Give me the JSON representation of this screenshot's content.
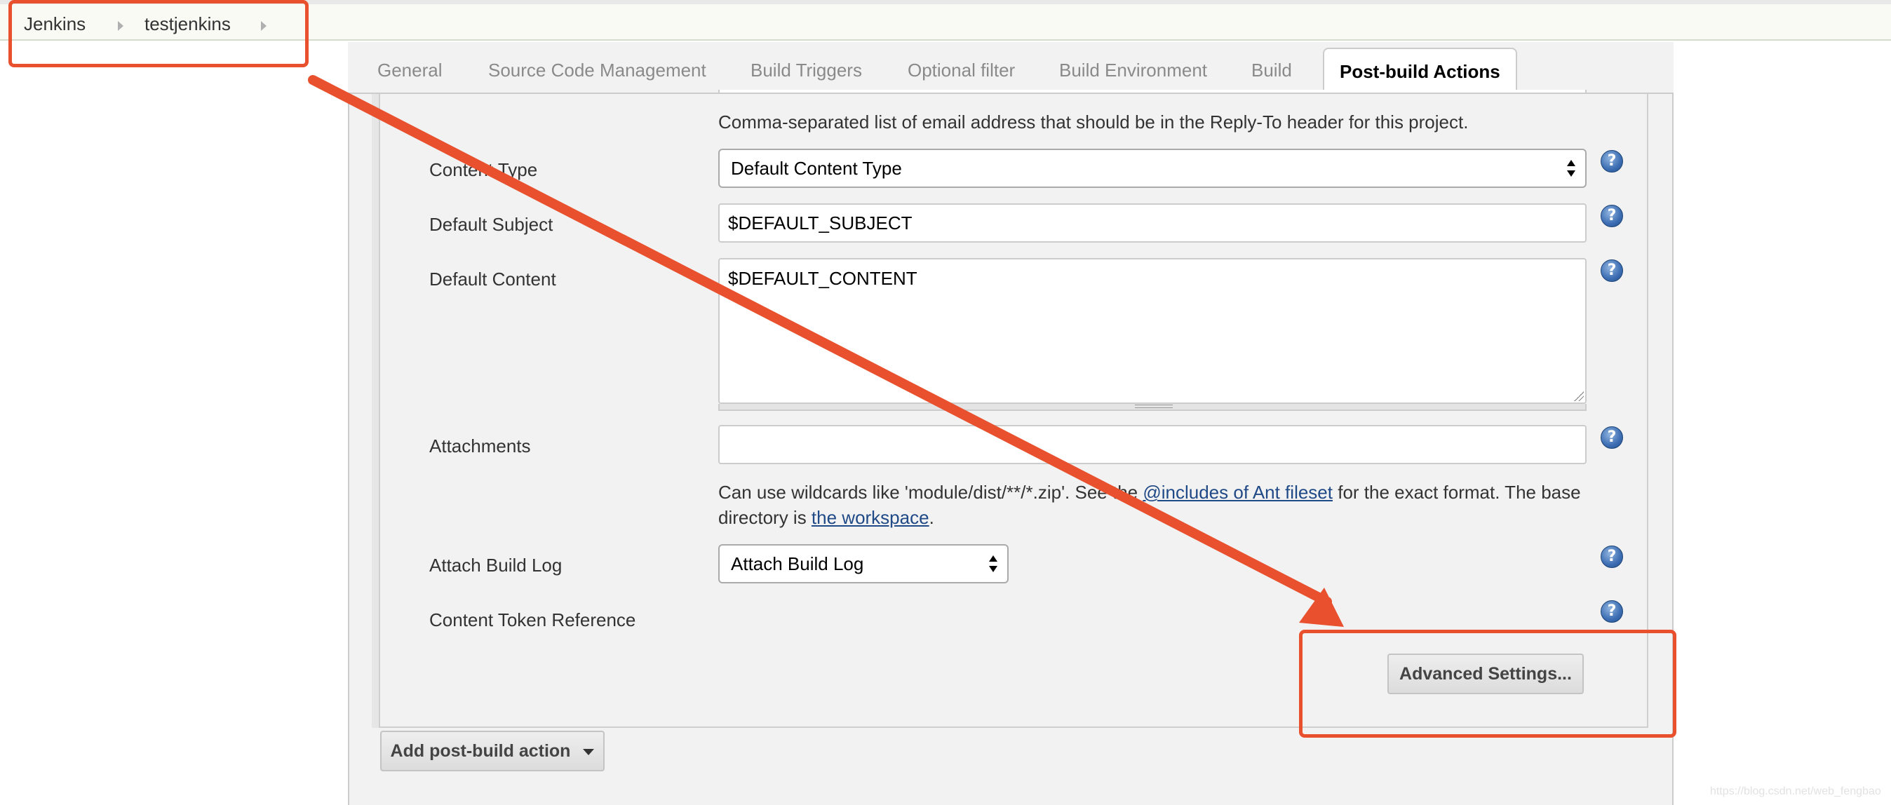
{
  "breadcrumb": {
    "items": [
      "Jenkins",
      "testjenkins"
    ]
  },
  "tabs": [
    {
      "label": "General",
      "active": false
    },
    {
      "label": "Source Code Management",
      "active": false
    },
    {
      "label": "Build Triggers",
      "active": false
    },
    {
      "label": "Optional filter",
      "active": false
    },
    {
      "label": "Build Environment",
      "active": false
    },
    {
      "label": "Build",
      "active": false
    },
    {
      "label": "Post-build Actions",
      "active": true
    }
  ],
  "form": {
    "reply_to_help": "Comma-separated list of email address that should be in the Reply-To header for this project.",
    "content_type": {
      "label": "Content Type",
      "value": "Default Content Type"
    },
    "default_subject": {
      "label": "Default Subject",
      "value": "$DEFAULT_SUBJECT"
    },
    "default_content": {
      "label": "Default Content",
      "value": "$DEFAULT_CONTENT"
    },
    "attachments": {
      "label": "Attachments",
      "value": "",
      "help_prefix": "Can use wildcards like 'module/dist/**/*.zip'. See the ",
      "help_link1": "@includes of Ant fileset",
      "help_middle": " for the exact format. The base directory is ",
      "help_link2": "the workspace",
      "help_suffix": "."
    },
    "attach_build_log": {
      "label": "Attach Build Log",
      "value": "Attach Build Log"
    },
    "content_token_reference": {
      "label": "Content Token Reference"
    },
    "help_glyph": "?"
  },
  "buttons": {
    "advanced_settings": "Advanced Settings...",
    "add_post_build_action": "Add post-build action"
  },
  "annotation_color": "#e8502e",
  "watermark": "https://blog.csdn.net/web_fengbao"
}
